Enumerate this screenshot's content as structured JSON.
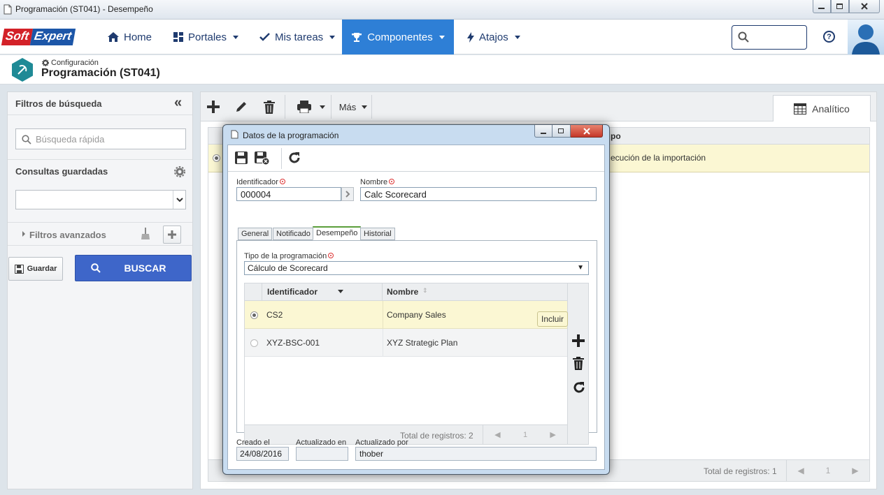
{
  "window": {
    "title": "Programación (ST041) - Desempeño"
  },
  "brand": {
    "soft": "Soft",
    "expert": "Expert"
  },
  "nav": {
    "items": [
      {
        "label": "Home",
        "icon": "home-icon"
      },
      {
        "label": "Portales",
        "icon": "grid-icon"
      },
      {
        "label": "Mis tareas",
        "icon": "check-icon"
      },
      {
        "label": "Componentes",
        "icon": "trophy-icon",
        "active": true
      },
      {
        "label": "Atajos",
        "icon": "bolt-icon"
      }
    ],
    "search_value": "",
    "help": "?"
  },
  "header": {
    "breadcrumb": "Configuración",
    "title": "Programación (ST041)"
  },
  "left_panel": {
    "title": "Filtros de búsqueda",
    "collapse": "«",
    "quick_search_placeholder": "Búsqueda rápida",
    "saved_queries_label": "Consultas guardadas",
    "saved_queries_value": "",
    "advanced_filters": "Filtros avanzados",
    "save_button": "Guardar",
    "search_button": "BUSCAR"
  },
  "main": {
    "toolbar": {
      "more": "Más"
    },
    "tab_label": "Analítico",
    "grid": {
      "header_visible": "po",
      "row_visible": "ecución de la importación",
      "footer": "Total de registros: 1",
      "page": "1"
    }
  },
  "dialog": {
    "title": "Datos de la programación",
    "identificador_label": "Identificador",
    "identificador_value": "000004",
    "nombre_label": "Nombre",
    "nombre_value": "Calc Scorecard",
    "tabs": [
      "General",
      "Notificado",
      "Desempeño",
      "Historial"
    ],
    "selected_tab": "Desempeño",
    "tipo_label": "Tipo de la programación",
    "tipo_value": "Cálculo de Scorecard",
    "grid": {
      "columns": [
        "Identificador",
        "Nombre"
      ],
      "rows": [
        {
          "id": "CS2",
          "name": "Company Sales",
          "selected": true
        },
        {
          "id": "XYZ-BSC-001",
          "name": "XYZ Strategic Plan",
          "selected": false
        }
      ],
      "footer": "Total de registros: 2",
      "page": "1"
    },
    "tooltip": "Incluir",
    "created_label": "Creado el",
    "created_value": "24/08/2016",
    "updated_label": "Actualizado en",
    "updated_value": "",
    "updated_by_label": "Actualizado por",
    "updated_by_value": "thober"
  },
  "colors": {
    "accent": "#2e7fd6",
    "brand_red": "#d32128",
    "brand_blue": "#1c56a8",
    "selected_row": "#fbf7d3",
    "search_button": "#3e66c9"
  }
}
